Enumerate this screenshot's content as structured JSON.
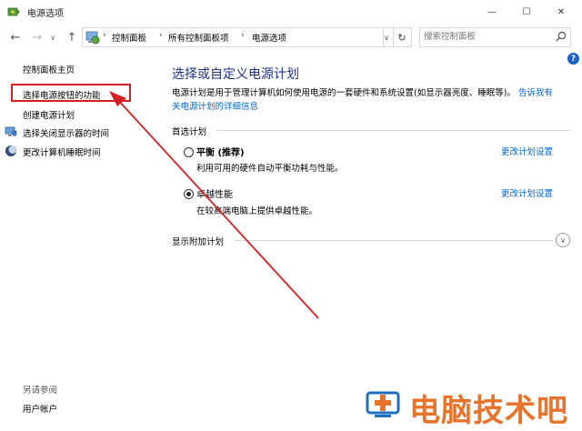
{
  "window": {
    "title": "电源选项",
    "min_glyph": "—",
    "max_glyph": "☐",
    "close_glyph": "✕"
  },
  "nav": {
    "back_glyph": "←",
    "forward_glyph": "→",
    "up_glyph": "↑",
    "dropdown_glyph": "∨",
    "refresh_glyph": "↻"
  },
  "breadcrumb": [
    "控制面板",
    "所有控制面板项",
    "电源选项"
  ],
  "breadcrumb_sep": "›",
  "search": {
    "placeholder": "搜索控制面板"
  },
  "help": {
    "glyph": "?"
  },
  "sidebar": {
    "home": "控制面板主页",
    "items": [
      {
        "label": "选择电源按钮的功能",
        "icon": null
      },
      {
        "label": "创建电源计划",
        "icon": null
      },
      {
        "label": "选择关闭显示器的时间",
        "icon": "monitor-shield-icon"
      },
      {
        "label": "更改计算机睡眠时间",
        "icon": "moon-icon"
      }
    ],
    "see_also_heading": "另请参阅",
    "see_also": [
      "用户帐户"
    ]
  },
  "main": {
    "title": "选择或自定义电源计划",
    "description": "电源计划是用于管理计算机如何使用电源的一套硬件和系统设置(如显示器亮度、睡眠等)。",
    "description_link_line1": "告诉我有",
    "description_link_line2": "关电源计划的详细信息",
    "preferred_label": "首选计划",
    "plans": [
      {
        "name": "平衡 (推荐)",
        "desc": "利用可用的硬件自动平衡功耗与性能。",
        "selected": false,
        "change_link": "更改计划设置"
      },
      {
        "name": "卓越性能",
        "desc": "在较高端电脑上提供卓越性能。",
        "selected": true,
        "change_link": "更改计划设置"
      }
    ],
    "additional_label": "显示附加计划",
    "expand_glyph": "∨"
  },
  "annotation": {
    "color": "#d42020"
  },
  "watermark": {
    "text": "电脑技术吧",
    "color": "#e8732a"
  },
  "colors": {
    "title": "#1e3287",
    "link": "#0066cc"
  }
}
